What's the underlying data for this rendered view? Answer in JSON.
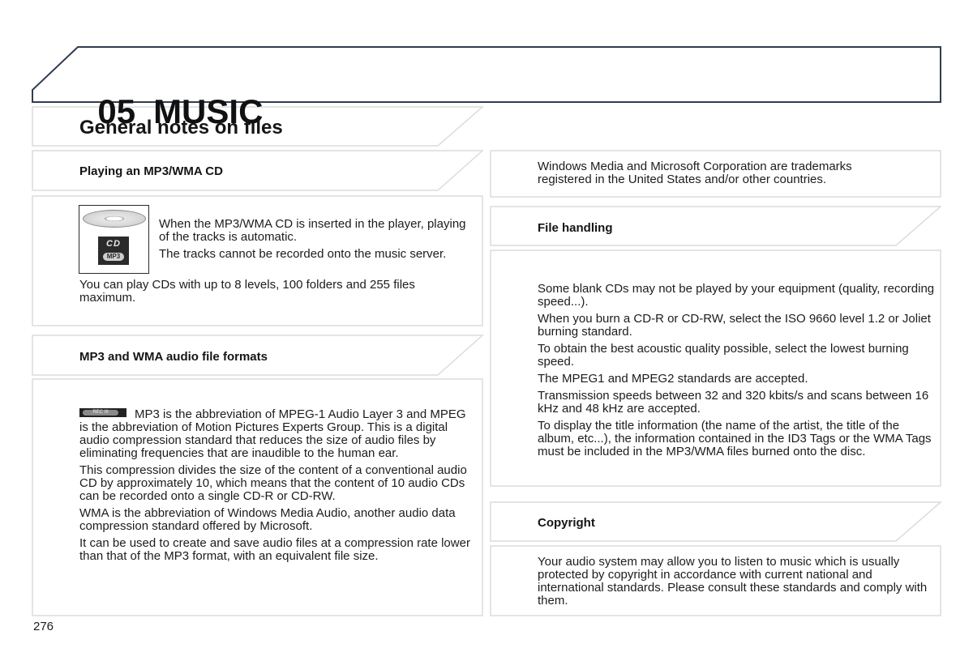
{
  "chapter": {
    "number": "05",
    "title": "MUSIC"
  },
  "section_title": "General notes on files",
  "left_column": {
    "playing": {
      "heading": "Playing an MP3/WMA CD",
      "icon": {
        "name": "cd-mp3-icon",
        "cd_label": "CD",
        "badge_label": "MP3"
      },
      "paragraphs": [
        "When the MP3/WMA CD is inserted in the player, playing of the tracks is automatic.",
        "The tracks cannot be recorded onto the music server."
      ],
      "note": "You can play CDs with up to 8 levels, 100 folders and 255 files maximum."
    },
    "formats": {
      "heading": "MP3 and WMA audio file formats",
      "icon": {
        "name": "rec-button-icon",
        "label": "REC III"
      },
      "paragraphs": [
        "MP3 is the abbreviation of MPEG-1 Audio Layer 3 and MPEG is the abbreviation of Motion Pictures Experts Group. This is a digital audio compression standard that reduces the size of audio files by eliminating frequencies that are inaudible to the human ear.",
        "This compression divides the size of the content of a conventional audio CD by approximately 10, which means that the content of 10 audio CDs can be recorded onto a single CD-R or CD-RW.",
        "WMA is the abbreviation of Windows Media Audio, another audio data compression standard offered by Microsoft.",
        "It can be used to create and save audio files at a compression rate lower than that of the MP3 format, with an equivalent file size."
      ]
    }
  },
  "right_column": {
    "trademark": "Windows Media and Microsoft Corporation are trademarks registered in the United States and/or other countries.",
    "file_handling": {
      "heading": "File handling",
      "paragraphs": [
        "Some blank CDs may not be played by your equipment (quality, recording speed...).",
        "When you burn a CD-R or CD-RW, select the ISO 9660 level 1.2 or Joliet burning standard.",
        "To obtain the best acoustic quality possible, select the lowest burning speed.",
        "The MPEG1 and MPEG2 standards are accepted.",
        "Transmission speeds between 32 and 320 kbits/s and scans between 16 kHz and 48 kHz are accepted.",
        "To display the title information (the name of the artist, the title of the album, etc...), the information contained in the ID3 Tags or the WMA Tags must be included in the MP3/WMA files burned onto the disc."
      ]
    },
    "copyright": {
      "heading": "Copyright",
      "text": "Your audio system may allow you to listen to music which is usually protected by copyright in accordance with current national and international standards. Please consult these standards and comply with them."
    }
  },
  "page_number": "276",
  "colors": {
    "header_border": "#2f3d4f",
    "box_border": "#dcdcdc",
    "text": "#1a1a1a"
  }
}
